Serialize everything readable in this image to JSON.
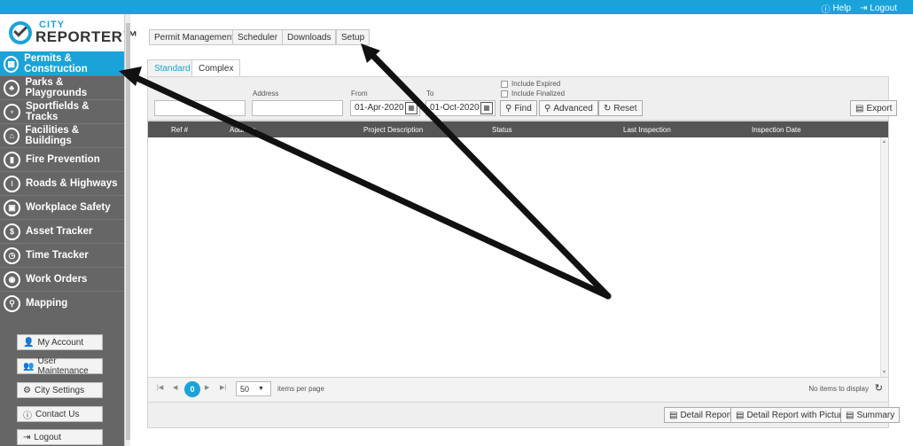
{
  "topbar": {
    "help": "Help",
    "logout": "Logout"
  },
  "logo": {
    "city": "CITY",
    "reporter": "REPORTER™"
  },
  "nav": [
    {
      "label": "Permits & Construction",
      "icon": "building-icon"
    },
    {
      "label": "Parks & Playgrounds",
      "icon": "tree-icon"
    },
    {
      "label": "Sportfields & Tracks",
      "icon": "trophy-icon"
    },
    {
      "label": "Facilities & Buildings",
      "icon": "facility-icon"
    },
    {
      "label": "Fire Prevention",
      "icon": "fire-extinguisher-icon"
    },
    {
      "label": "Roads & Highways",
      "icon": "traffic-light-icon"
    },
    {
      "label": "Workplace Safety",
      "icon": "workplace-icon"
    },
    {
      "label": "Asset Tracker",
      "icon": "asset-hand-icon"
    },
    {
      "label": "Time Tracker",
      "icon": "clock-icon"
    },
    {
      "label": "Work Orders",
      "icon": "work-order-icon"
    },
    {
      "label": "Mapping",
      "icon": "map-icon"
    }
  ],
  "account": {
    "my_account": "My Account",
    "user_maintenance": "User Maintenance",
    "city_settings": "City Settings",
    "contact_us": "Contact Us",
    "logout": "Logout"
  },
  "menu": {
    "permit_management": "Permit Management",
    "scheduler": "Scheduler",
    "downloads": "Downloads",
    "setup": "Setup"
  },
  "tabs": {
    "standard": "Standard",
    "complex": "Complex"
  },
  "filters": {
    "address_label": "Address",
    "from_label": "From",
    "from_value": "01-Apr-2020",
    "to_label": "To",
    "to_value": "01-Oct-2020",
    "include_expired": "Include Expired",
    "include_finalized": "Include Finalized",
    "find": "Find",
    "advanced": "Advanced",
    "reset": "Reset",
    "export": "Export"
  },
  "columns": {
    "ref": "Ref #",
    "address": "Address",
    "project": "Project Description",
    "status": "Status",
    "last_inspection": "Last Inspection",
    "inspection_date": "Inspection Date"
  },
  "pager": {
    "current_page": "0",
    "page_size": "50",
    "items_per_page": "items per page",
    "no_items": "No items to display"
  },
  "reports": {
    "detail": "Detail Report",
    "detail_pictures": "Detail Report with Pictures",
    "summary": "Summary"
  }
}
